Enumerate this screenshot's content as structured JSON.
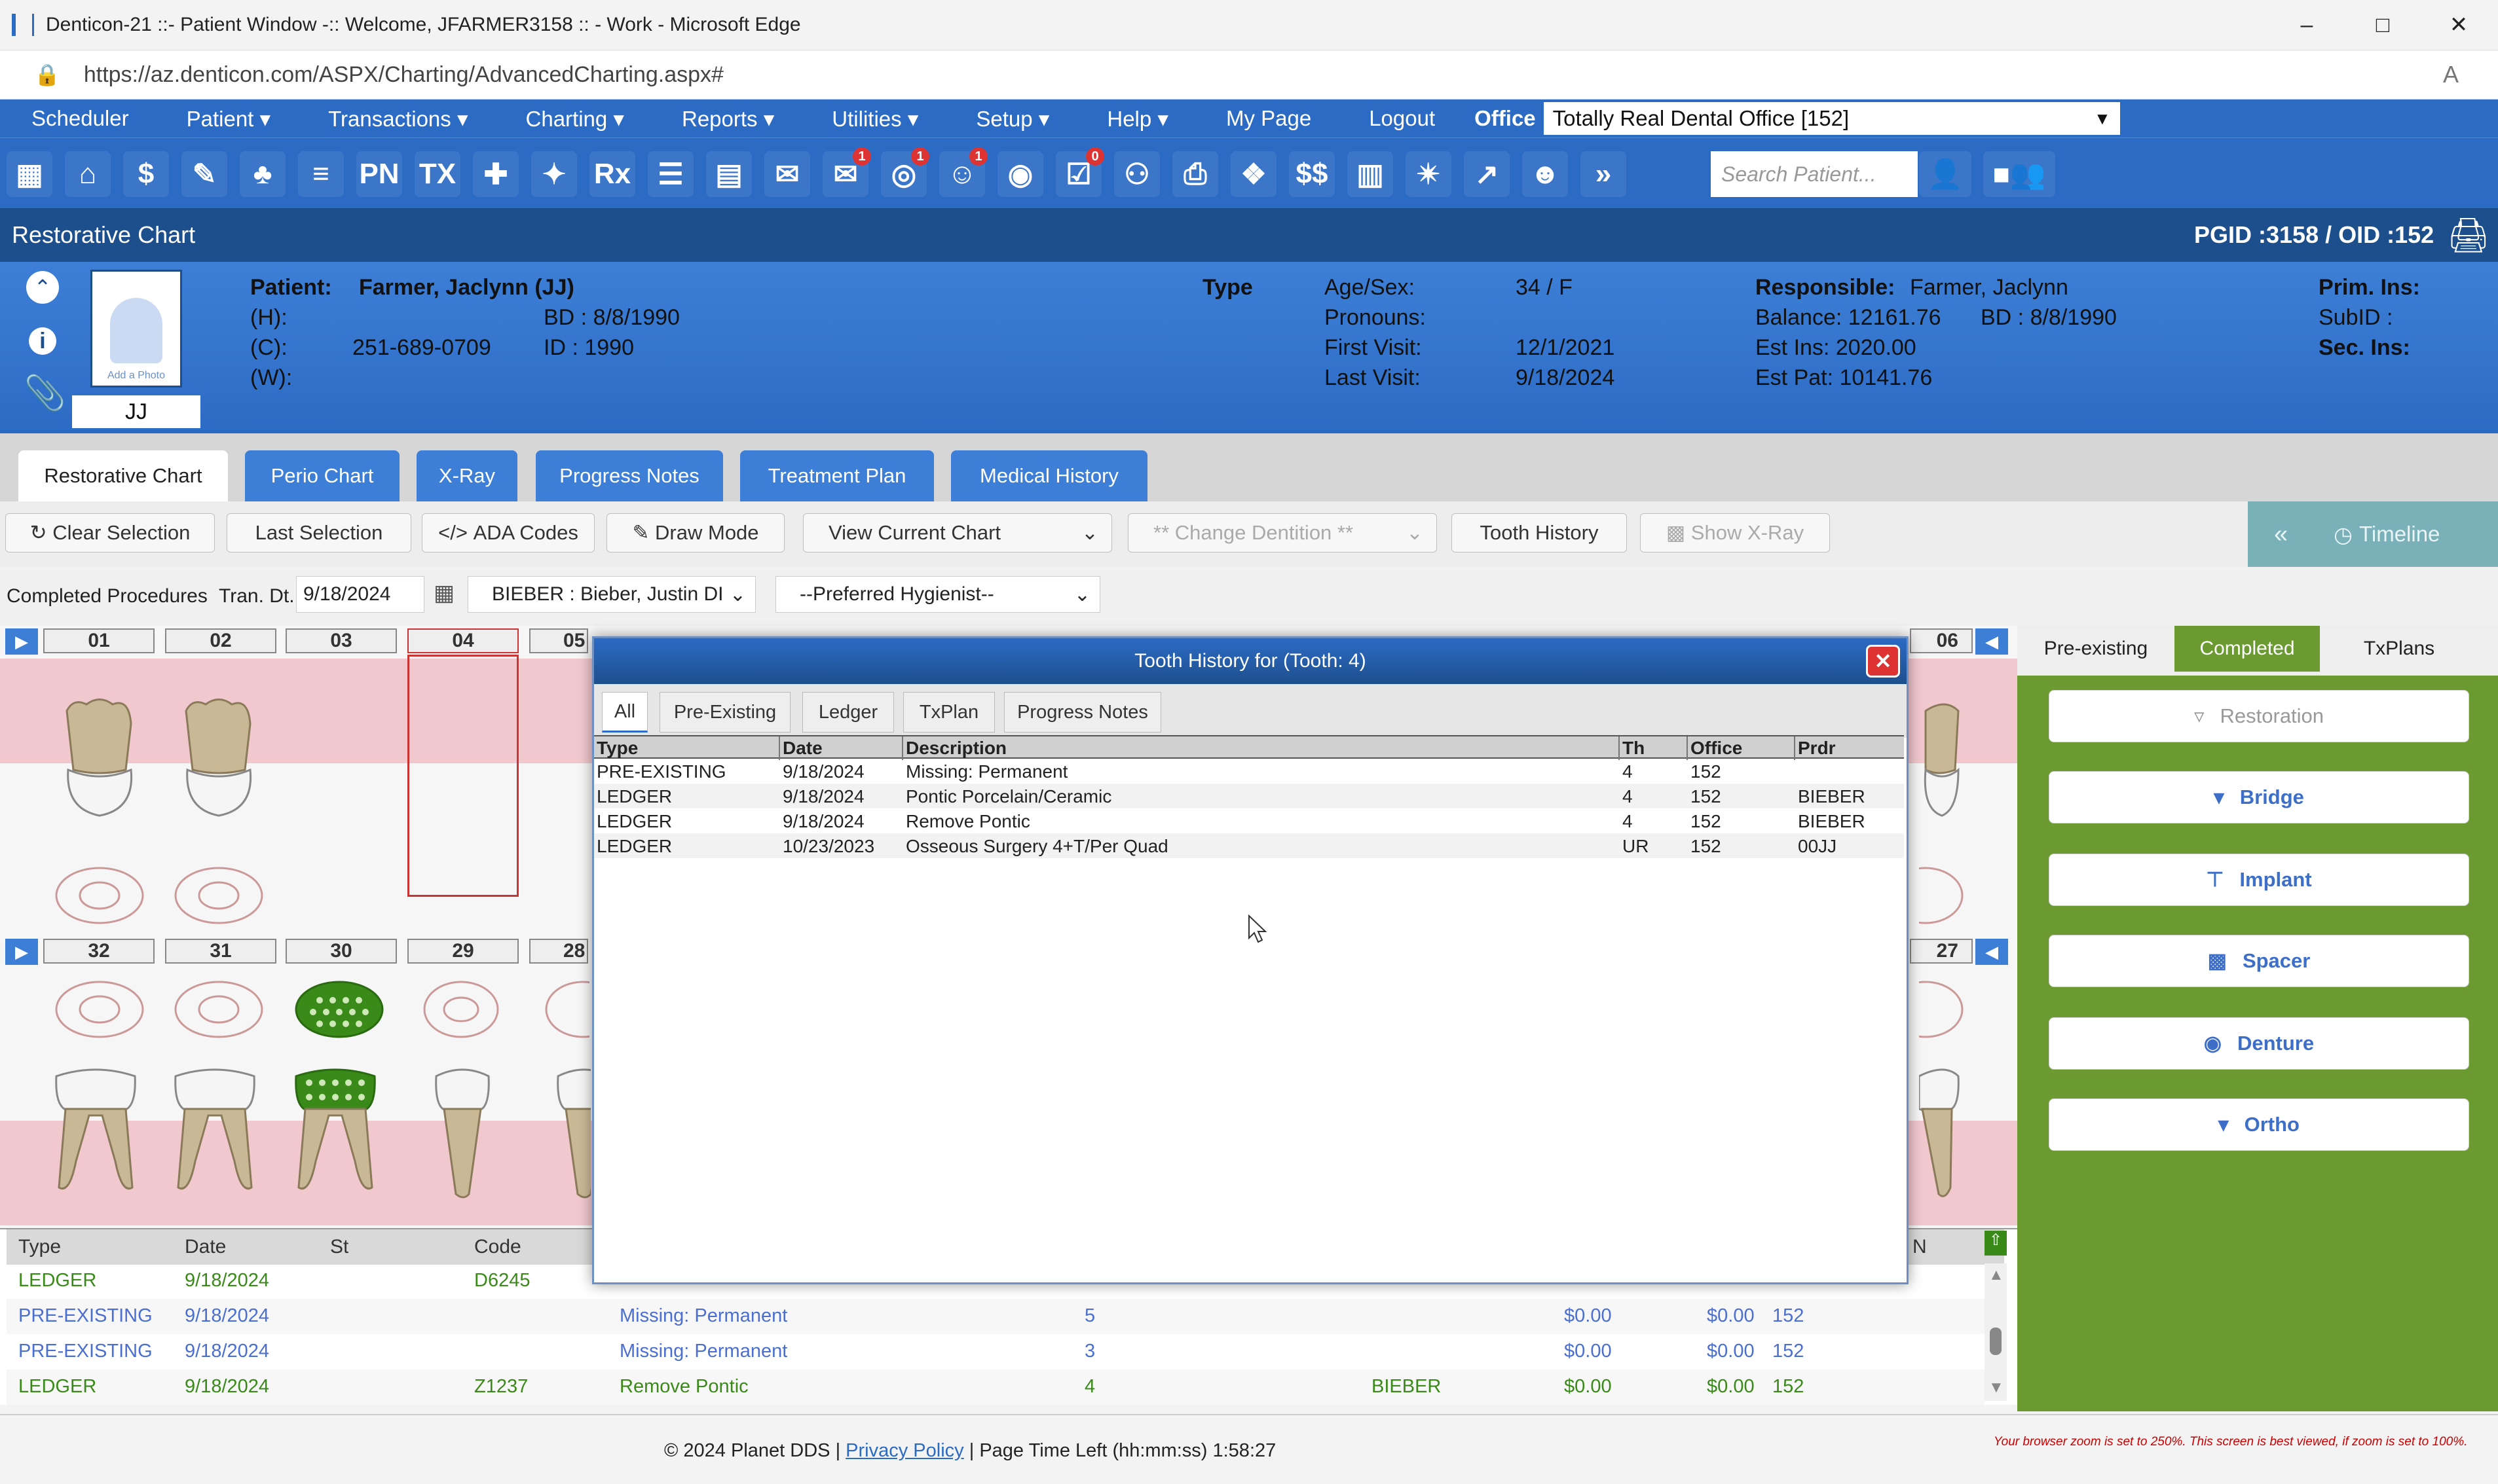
{
  "window": {
    "title": "Denticon-21 ::- Patient Window -:: Welcome, JFARMER3158 :: - Work - Microsoft Edge",
    "url": "https://az.denticon.com/ASPX/Charting/AdvancedCharting.aspx#"
  },
  "menu": {
    "items": [
      "Scheduler",
      "Patient",
      "Transactions",
      "Charting",
      "Reports",
      "Utilities",
      "Setup",
      "Help",
      "My Page",
      "Logout"
    ],
    "office_label": "Office",
    "office_value": "Totally Real Dental Office [152]"
  },
  "toolbar": {
    "search_placeholder": "Search Patient...",
    "icons": [
      "calendar-icon",
      "home-icon",
      "dollar-icon",
      "notes-icon",
      "tooth-icon",
      "teeth-icon",
      "pn-icon",
      "tx-icon",
      "add-patient-icon",
      "add-family-icon",
      "rx-icon",
      "message-icon",
      "document-icon",
      "mail-icon",
      "sms-icon",
      "globe-icon",
      "support-icon",
      "web-icon",
      "tasks-icon",
      "people-icon",
      "printer-icon",
      "shield-icon",
      "money-icon",
      "ledger-icon",
      "network-icon",
      "chart-icon",
      "user-circle-icon",
      "chevrons-icon"
    ],
    "badges": {
      "sms": "1",
      "globe": "1",
      "support": "1",
      "tasks": "0"
    },
    "pn": "PN",
    "tx": "TX",
    "rx": "Rx"
  },
  "section": {
    "title": "Restorative Chart",
    "ids": "PGID :3158  /  OID :152"
  },
  "patient": {
    "initials": "JJ",
    "add_photo": "Add a Photo",
    "patient_label": "Patient:",
    "name": "Farmer, Jaclynn (JJ)",
    "h_label": "(H):",
    "c_label": "(C):",
    "c_value": "251-689-0709",
    "w_label": "(W):",
    "bd": "BD : 8/8/1990",
    "id": "ID : 1990",
    "type_label": "Type",
    "age_label": "Age/Sex:",
    "age_value": "34 / F",
    "pronouns_label": "Pronouns:",
    "first_visit_label": "First Visit:",
    "first_visit": "12/1/2021",
    "last_visit_label": "Last Visit:",
    "last_visit": "9/18/2024",
    "responsible_label": "Responsible:",
    "responsible": "Farmer, Jaclynn",
    "balance": "Balance:  12161.76",
    "resp_bd": "BD : 8/8/1990",
    "est_ins": "Est Ins:  2020.00",
    "est_pat": "Est Pat: 10141.76",
    "prim_ins": "Prim. Ins:",
    "subid": "SubID :",
    "sec_ins": "Sec. Ins:"
  },
  "tabs": [
    "Restorative Chart",
    "Perio Chart",
    "X-Ray",
    "Progress Notes",
    "Treatment Plan",
    "Medical History"
  ],
  "actions": {
    "clear": "Clear Selection",
    "last": "Last Selection",
    "ada": "ADA Codes",
    "draw": "Draw Mode",
    "view": "View Current Chart",
    "dentition": "** Change Dentition **",
    "history": "Tooth History",
    "xray": "Show X-Ray",
    "timeline": "Timeline"
  },
  "procedures": {
    "label": "Completed Procedures",
    "tran_label": "Tran. Dt.",
    "tran_date": "9/18/2024",
    "provider": "BIEBER : Bieber, Justin DI",
    "hygienist": "--Preferred Hygienist--"
  },
  "teeth_upper": [
    "01",
    "02",
    "03",
    "04",
    "05",
    "06"
  ],
  "teeth_lower": [
    "32",
    "31",
    "30",
    "29",
    "28",
    "27"
  ],
  "bottom_table": {
    "headers": [
      "Type",
      "Date",
      "St",
      "Code",
      "N"
    ],
    "rows": [
      {
        "type": "LEDGER",
        "date": "9/18/2024",
        "code": "D6245",
        "desc": "",
        "tooth": "",
        "prdr": "",
        "fee": "",
        "ins": "",
        "off": ""
      },
      {
        "type": "PRE-EXISTING",
        "date": "9/18/2024",
        "code": "",
        "desc": "Missing: Permanent",
        "tooth": "5",
        "prdr": "",
        "fee": "$0.00",
        "ins": "$0.00",
        "off": "152"
      },
      {
        "type": "PRE-EXISTING",
        "date": "9/18/2024",
        "code": "",
        "desc": "Missing: Permanent",
        "tooth": "3",
        "prdr": "",
        "fee": "$0.00",
        "ins": "$0.00",
        "off": "152"
      },
      {
        "type": "LEDGER",
        "date": "9/18/2024",
        "code": "Z1237",
        "desc": "Remove Pontic",
        "tooth": "4",
        "prdr": "BIEBER",
        "fee": "$0.00",
        "ins": "$0.00",
        "off": "152"
      }
    ]
  },
  "right_panel": {
    "tabs": [
      "Pre-existing",
      "Completed",
      "TxPlans"
    ],
    "buttons": [
      "Restoration",
      "Bridge",
      "Implant",
      "Spacer",
      "Denture",
      "Ortho"
    ]
  },
  "dialog": {
    "title": "Tooth History for (Tooth: 4)",
    "tabs": [
      "All",
      "Pre-Existing",
      "Ledger",
      "TxPlan",
      "Progress Notes"
    ],
    "headers": [
      "Type",
      "Date",
      "Description",
      "Th",
      "Office",
      "Prdr"
    ],
    "rows": [
      {
        "type": "PRE-EXISTING",
        "date": "9/18/2024",
        "desc": "Missing: Permanent",
        "th": "4",
        "office": "152",
        "prdr": ""
      },
      {
        "type": "LEDGER",
        "date": "9/18/2024",
        "desc": "Pontic Porcelain/Ceramic",
        "th": "4",
        "office": "152",
        "prdr": "BIEBER"
      },
      {
        "type": "LEDGER",
        "date": "9/18/2024",
        "desc": "Remove Pontic",
        "th": "4",
        "office": "152",
        "prdr": "BIEBER"
      },
      {
        "type": "LEDGER",
        "date": "10/23/2023",
        "desc": "Osseous Surgery 4+T/Per Quad",
        "th": "UR",
        "office": "152",
        "prdr": "00JJ"
      }
    ]
  },
  "footer": {
    "copyright": "© 2024 Planet DDS |",
    "privacy": "Privacy Policy",
    "time_left": "|  Page Time Left (hh:mm:ss) 1:58:27",
    "zoom_warning": "Your browser zoom is set to 250%. This screen is best viewed, if zoom is set to 100%."
  },
  "colors": {
    "brand": "#2c6bc4",
    "panel_green": "#6a9a30",
    "ledger_green": "#3a8a1a",
    "preexisting_blue": "#4a6fd0"
  }
}
